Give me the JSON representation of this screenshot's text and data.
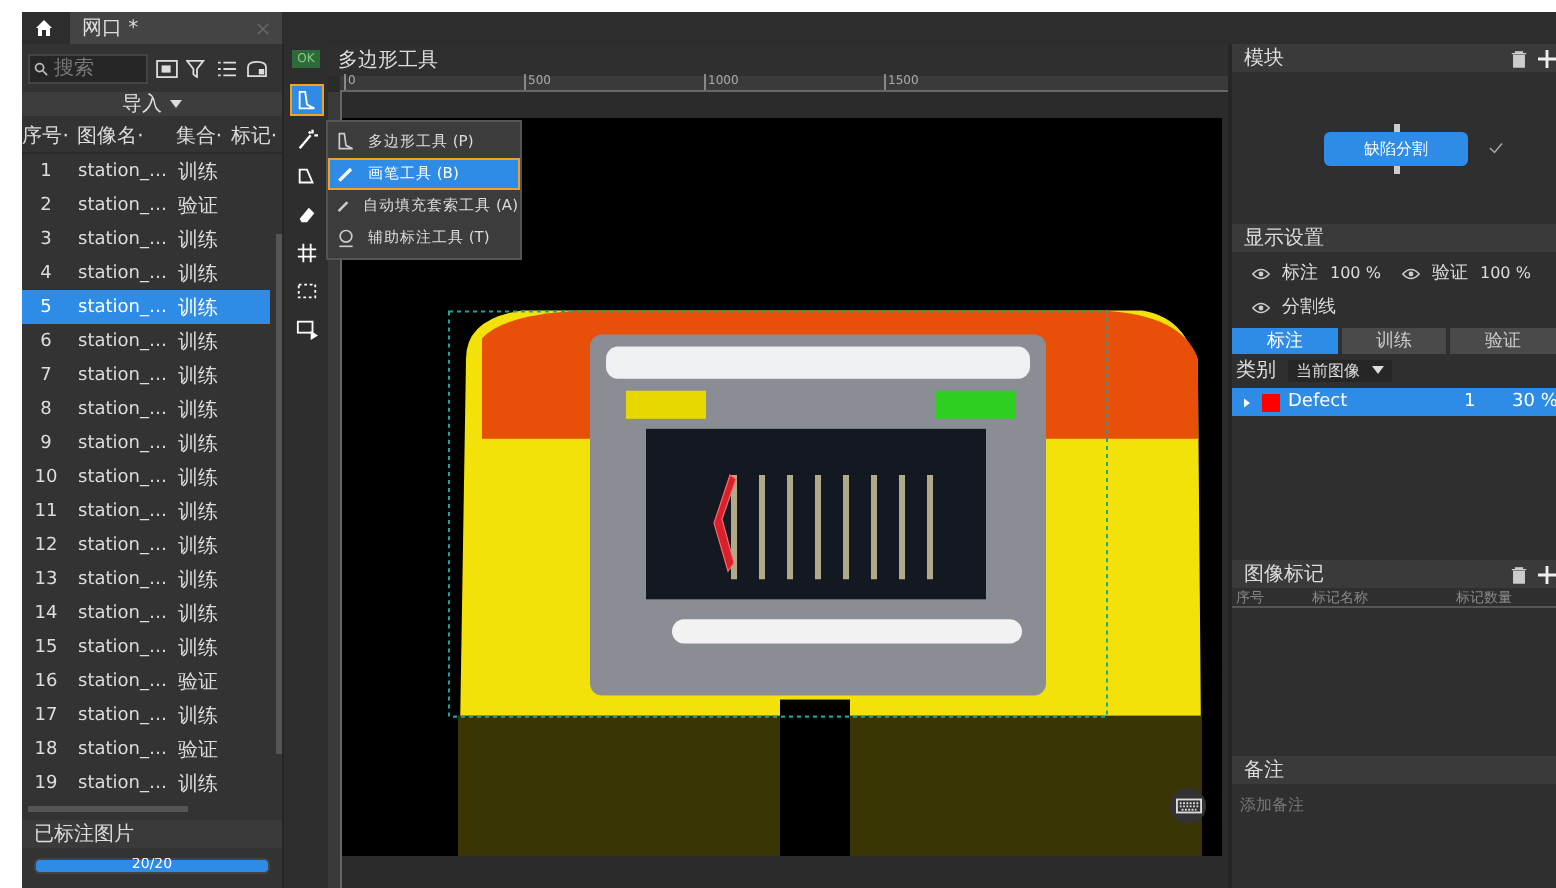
{
  "tab": {
    "title": "网口 *"
  },
  "sidebar": {
    "search": {
      "placeholder": "搜索"
    },
    "import_button": "导入",
    "columns": [
      "序号·",
      "图像名·",
      "集合·",
      "标记·"
    ],
    "rows": [
      {
        "index": "1",
        "name": "station_…",
        "set": "训练",
        "selected": false
      },
      {
        "index": "2",
        "name": "station_…",
        "set": "验证",
        "selected": false
      },
      {
        "index": "3",
        "name": "station_…",
        "set": "训练",
        "selected": false
      },
      {
        "index": "4",
        "name": "station_…",
        "set": "训练",
        "selected": false
      },
      {
        "index": "5",
        "name": "station_…",
        "set": "训练",
        "selected": true
      },
      {
        "index": "6",
        "name": "station_…",
        "set": "训练",
        "selected": false
      },
      {
        "index": "7",
        "name": "station_…",
        "set": "训练",
        "selected": false
      },
      {
        "index": "8",
        "name": "station_…",
        "set": "训练",
        "selected": false
      },
      {
        "index": "9",
        "name": "station_…",
        "set": "训练",
        "selected": false
      },
      {
        "index": "10",
        "name": "station_…",
        "set": "训练",
        "selected": false
      },
      {
        "index": "11",
        "name": "station_…",
        "set": "训练",
        "selected": false
      },
      {
        "index": "12",
        "name": "station_…",
        "set": "训练",
        "selected": false
      },
      {
        "index": "13",
        "name": "station_…",
        "set": "训练",
        "selected": false
      },
      {
        "index": "14",
        "name": "station_…",
        "set": "训练",
        "selected": false
      },
      {
        "index": "15",
        "name": "station_…",
        "set": "训练",
        "selected": false
      },
      {
        "index": "16",
        "name": "station_…",
        "set": "验证",
        "selected": false
      },
      {
        "index": "17",
        "name": "station_…",
        "set": "训练",
        "selected": false
      },
      {
        "index": "18",
        "name": "station_…",
        "set": "验证",
        "selected": false
      },
      {
        "index": "19",
        "name": "station_…",
        "set": "训练",
        "selected": false
      }
    ],
    "footer": {
      "title": "已标注图片",
      "progress": {
        "level": 1,
        "text": "20/20"
      }
    }
  },
  "toolbar": {
    "badge": "OK",
    "tools": [
      {
        "kind": "polygon",
        "selected": true
      },
      {
        "kind": "wand",
        "selected": false
      },
      {
        "kind": "polygon-brush",
        "selected": false
      },
      {
        "kind": "eraser",
        "selected": false
      },
      {
        "kind": "grid",
        "selected": false
      },
      {
        "kind": "dashed-rect",
        "selected": false
      },
      {
        "kind": "rect-play",
        "selected": false
      }
    ]
  },
  "tool_menu": {
    "items": [
      {
        "label": "多边形工具 (P)",
        "kind": "polygon",
        "selected": false
      },
      {
        "label": "画笔工具 (B)",
        "kind": "brush",
        "selected": true
      },
      {
        "label": "自动填充套索工具 (A)",
        "kind": "fill",
        "selected": false
      },
      {
        "label": "辅助标注工具 (T)",
        "kind": "assist",
        "selected": false
      }
    ]
  },
  "canvas": {
    "title": "多边形工具",
    "ruler_labels": [
      "0",
      "500",
      "1000",
      "1500"
    ]
  },
  "module": {
    "title": "模块",
    "node": "缺陷分割",
    "done": true
  },
  "display": {
    "title": "显示设置",
    "toggles": [
      {
        "label": "标注",
        "value": "100 %"
      },
      {
        "label": "验证",
        "value": "100 %"
      },
      {
        "label": "分割线"
      }
    ]
  },
  "tabs": [
    {
      "label": "标注",
      "selected": true
    },
    {
      "label": "训练",
      "selected": false
    },
    {
      "label": "验证",
      "selected": false
    }
  ],
  "class_filter": {
    "label": "类别",
    "dropdown": "当前图像"
  },
  "classes": [
    {
      "name": "Defect",
      "color": "#ff0000",
      "count": "1",
      "percent": "30 %",
      "selected": true
    }
  ],
  "image_tags": {
    "title": "图像标记",
    "columns": [
      "序号",
      "标记名称",
      "标记数量"
    ]
  },
  "notes": {
    "title": "备注",
    "placeholder": "添加备注"
  }
}
